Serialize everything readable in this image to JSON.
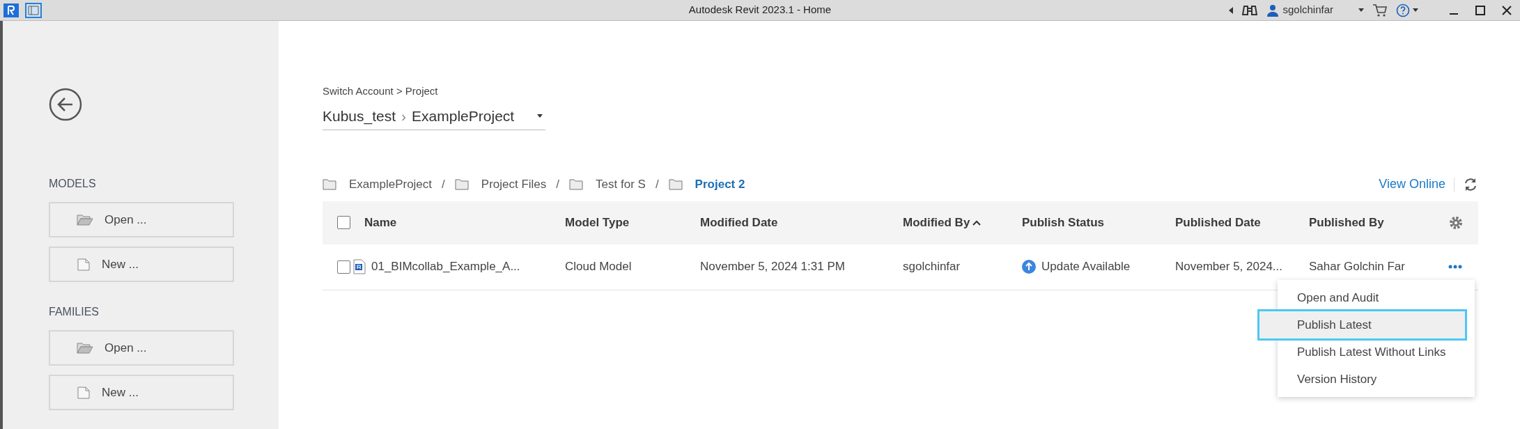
{
  "window": {
    "title": "Autodesk Revit 2023.1 - Home",
    "user": "sgolchinfar"
  },
  "sidebar": {
    "sections": [
      {
        "heading": "MODELS",
        "buttons": [
          {
            "label": "Open ...",
            "kind": "open"
          },
          {
            "label": "New ...",
            "kind": "new"
          }
        ]
      },
      {
        "heading": "FAMILIES",
        "buttons": [
          {
            "label": "Open ...",
            "kind": "open"
          },
          {
            "label": "New ...",
            "kind": "new"
          }
        ]
      }
    ]
  },
  "header": {
    "breadcrumb": "Switch Account > Project",
    "account": "Kubus_test",
    "separator": "›",
    "project": "ExampleProject"
  },
  "folder_path": {
    "separator": "/",
    "folders": [
      {
        "label": "ExampleProject",
        "current": false
      },
      {
        "label": "Project Files",
        "current": false
      },
      {
        "label": "Test for S",
        "current": false
      },
      {
        "label": "Project 2",
        "current": true
      }
    ]
  },
  "view_online": "View Online",
  "table": {
    "select_all": false,
    "columns": [
      {
        "label": "Name",
        "sorted": false
      },
      {
        "label": "Model Type",
        "sorted": false
      },
      {
        "label": "Modified Date",
        "sorted": false
      },
      {
        "label": "Modified By",
        "sorted": true
      },
      {
        "label": "Publish Status",
        "sorted": false
      },
      {
        "label": "Published Date",
        "sorted": false
      },
      {
        "label": "Published By",
        "sorted": false
      }
    ],
    "rows": [
      {
        "checked": false,
        "cells": [
          "01_BIMcollab_Example_A...",
          "Cloud Model",
          "November 5, 2024 1:31 PM",
          "sgolchinfar",
          "Update Available",
          "November 5, 2024...",
          "Sahar Golchin Far"
        ]
      }
    ]
  },
  "context_menu": {
    "items": [
      {
        "label": "Open and Audit",
        "selected": false
      },
      {
        "label": "Publish Latest",
        "selected": true
      },
      {
        "label": "Publish Latest Without Links",
        "selected": false
      },
      {
        "label": "Version History",
        "selected": false
      }
    ]
  }
}
